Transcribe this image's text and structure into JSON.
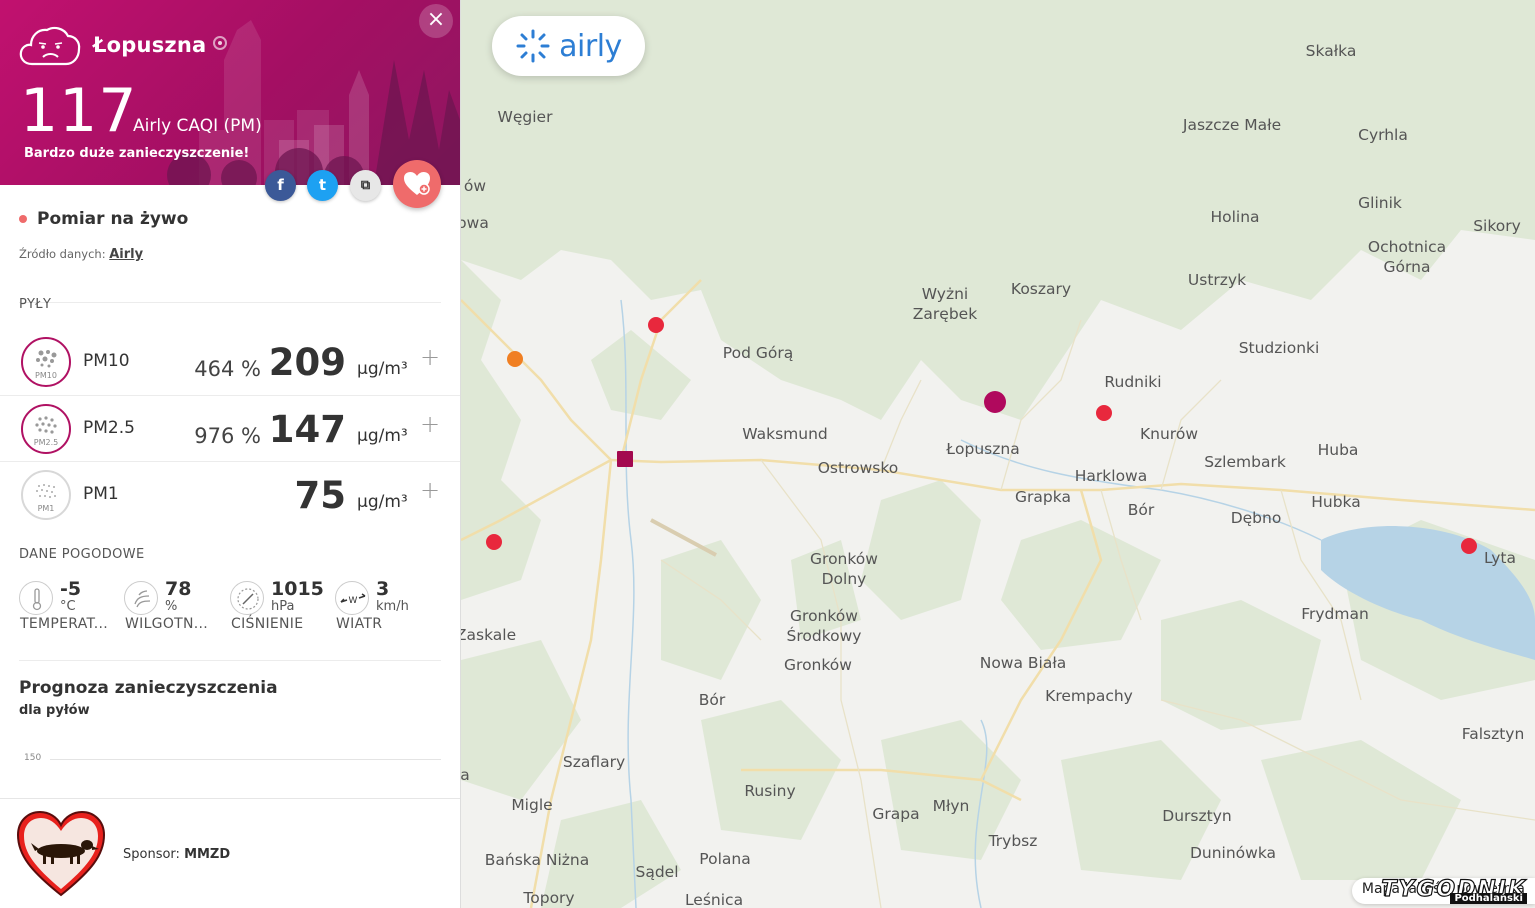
{
  "station": {
    "name": "Łopuszna",
    "caqi_value": "117",
    "caqi_label": "Airly CAQI (PM)",
    "description": "Bardzo duże zanieczyszczenie!",
    "close_label": "×"
  },
  "share": {
    "facebook": "f",
    "twitter": "t",
    "copy": "⧉"
  },
  "live": {
    "label": "Pomiar na żywo",
    "source_prefix": "Źródło danych:",
    "source_link": "Airly"
  },
  "particles": {
    "section_title": "PYŁY",
    "rows": [
      {
        "name": "PM10",
        "icon_label": "PM10",
        "percent": "464 %",
        "value": "209",
        "unit": "µg/m³",
        "ring_color": "#b01163"
      },
      {
        "name": "PM2.5",
        "icon_label": "PM2.5",
        "percent": "976 %",
        "value": "147",
        "unit": "µg/m³",
        "ring_color": "#b01163"
      },
      {
        "name": "PM1",
        "icon_label": "PM1",
        "percent": "",
        "value": "75",
        "unit": "µg/m³",
        "ring_color": "#d8d8d8"
      }
    ],
    "plus_label": "+"
  },
  "weather": {
    "section_title": "DANE POGODOWE",
    "items": [
      {
        "icon": "thermometer-icon",
        "value": "-5",
        "unit": "°C",
        "label": "TEMPERAT..."
      },
      {
        "icon": "humidity-icon",
        "value": "78",
        "unit": "%",
        "label": "WILGOTN..."
      },
      {
        "icon": "pressure-icon",
        "value": "1015",
        "unit": "hPa",
        "label": "CIŚNIENIE"
      },
      {
        "icon": "wind-icon",
        "value": "3",
        "unit": "km/h",
        "label": "WIATR"
      }
    ],
    "wind_direction": "W"
  },
  "forecast": {
    "title": "Prognoza zanieczyszczenia",
    "subtitle": "dla pyłów",
    "axis_tick": "150"
  },
  "sponsor": {
    "prefix": "Sponsor:",
    "name": "MMZD"
  },
  "map": {
    "logo_text": "airly",
    "bottom_button": "Mapa jakości powietrza",
    "watermark_big": "TYGODNIK",
    "watermark_small": "Podhalański",
    "places": [
      "Węgier",
      "Skałka",
      "Jaszcze Małe",
      "Cyrhla",
      "Holina",
      "Glinik",
      "Sikory",
      "Ochotnica\nGórna",
      "Ustrzyk",
      "Wyżni\nZarębek",
      "Koszary",
      "Pod Górą",
      "Studzionki",
      "Rudniki",
      "Waksmund",
      "Łopuszna",
      "Knurów",
      "Huba",
      "Ostrowsko",
      "Szlembark",
      "Harklowa",
      "Grapka",
      "Hubka",
      "Bór",
      "Dębno",
      "Lyta",
      "Gronków\nDolny",
      "Frydman",
      "Gronków\nŚrodkowy",
      "Zaskale",
      "Gronków",
      "Nowa Biała",
      "Krempachy",
      "Bór",
      "Falsztyn",
      "Szaflary",
      "Rusiny",
      "Migle",
      "Grapa",
      "Młyn",
      "Dursztyn",
      "Trybsz",
      "Bańska Niżna",
      "Duninówka",
      "Sądel",
      "Polana",
      "Topory",
      "Leśnica",
      "ów",
      "owa",
      "a"
    ],
    "sensor_colors": {
      "very_high": "#b0095d",
      "high": "#e8283d",
      "medium": "#f07f22",
      "extreme": "#a3094f"
    }
  }
}
